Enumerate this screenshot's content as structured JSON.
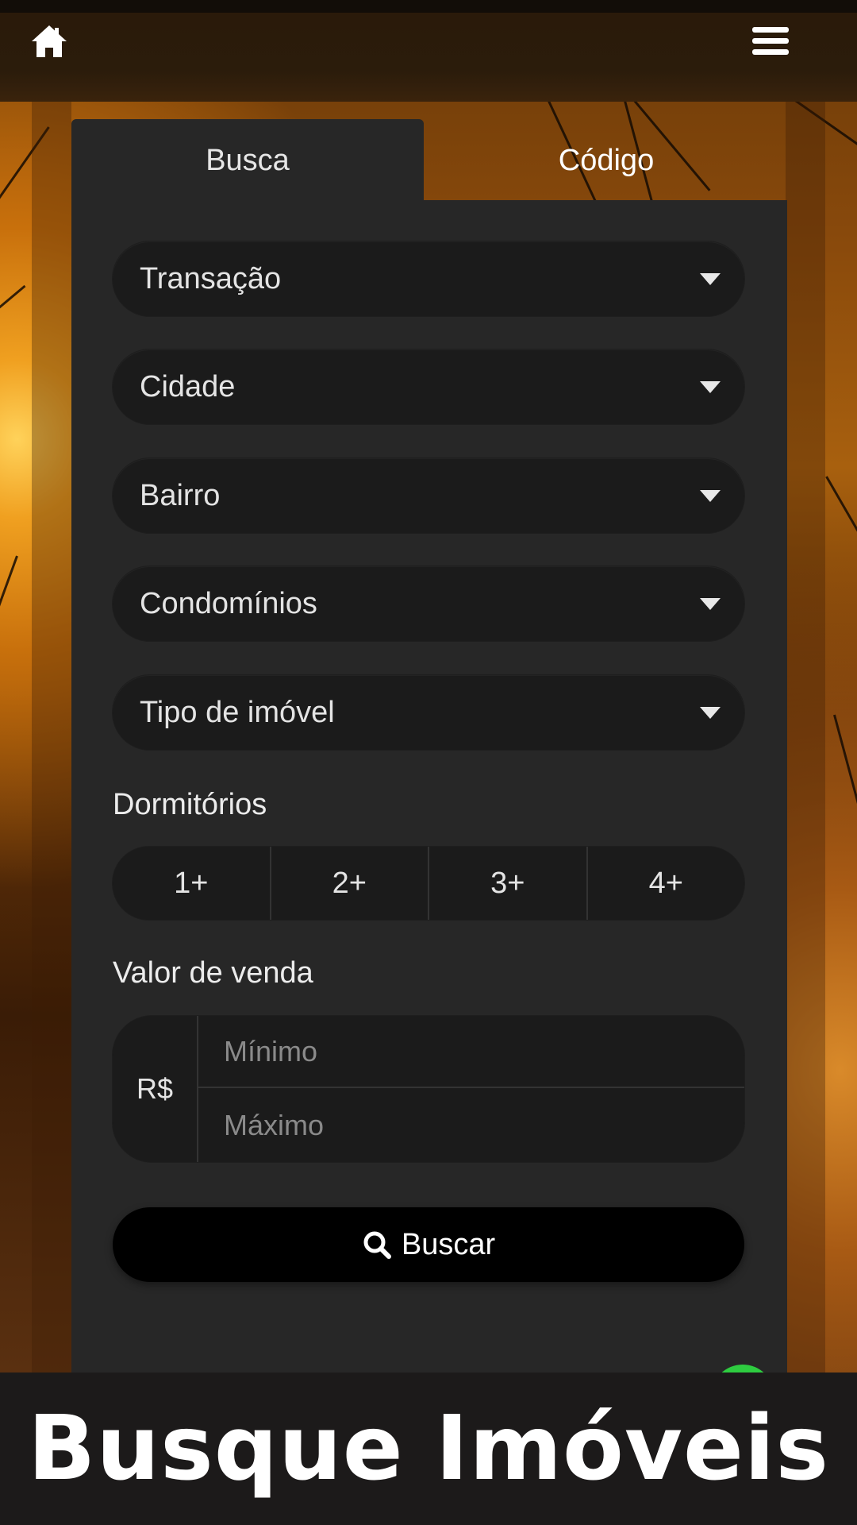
{
  "header": {
    "home_icon": "home-icon",
    "menu_icon": "hamburger-menu-icon"
  },
  "tabs": [
    {
      "label": "Busca",
      "active": true
    },
    {
      "label": "Código",
      "active": false
    }
  ],
  "filters": {
    "transacao": "Transação",
    "cidade": "Cidade",
    "bairro": "Bairro",
    "condominios": "Condomínios",
    "tipo_imovel": "Tipo de imóvel"
  },
  "dormitorios": {
    "label": "Dormitórios",
    "options": [
      "1+",
      "2+",
      "3+",
      "4+"
    ]
  },
  "valor": {
    "label": "Valor de venda",
    "currency": "R$",
    "min_placeholder": "Mínimo",
    "max_placeholder": "Máximo"
  },
  "search_button": {
    "label": "Buscar",
    "icon": "search-icon"
  },
  "banner": {
    "text": "Busque Imóveis"
  },
  "colors": {
    "panel": "#272727",
    "field": "#1b1b1b",
    "button": "#000000",
    "text": "#e4e4e4",
    "accent_green": "#2ecc40"
  }
}
